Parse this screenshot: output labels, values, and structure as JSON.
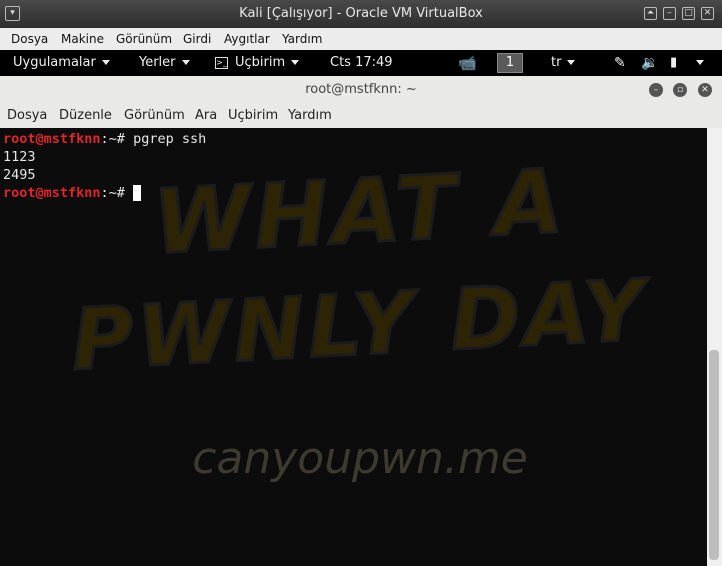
{
  "vbox": {
    "title": "Kali [Çalışıyor] - Oracle VM VirtualBox",
    "menu": [
      "Dosya",
      "Makine",
      "Görünüm",
      "Girdi",
      "Aygıtlar",
      "Yardım"
    ]
  },
  "kali_panel": {
    "applications": "Uygulamalar",
    "places": "Yerler",
    "terminal_app": "Uçbirim",
    "clock": "Cts 17:49",
    "workspace": "1",
    "keyboard_layout": "tr"
  },
  "terminal": {
    "title": "root@mstfknn: ~",
    "menu": [
      "Dosya",
      "Düzenle",
      "Görünüm",
      "Ara",
      "Uçbirim",
      "Yardım"
    ],
    "lines": [
      {
        "prompt": "root@mstfknn",
        "path": ":~# ",
        "command": "pgrep ssh"
      },
      {
        "output": "1123"
      },
      {
        "output": "2495"
      },
      {
        "prompt": "root@mstfknn",
        "path": ":~# ",
        "command": ""
      }
    ]
  },
  "wallpaper": {
    "line1": "WHAT A",
    "line2": "PWNLY DAY",
    "url": "canyoupwn.me"
  }
}
